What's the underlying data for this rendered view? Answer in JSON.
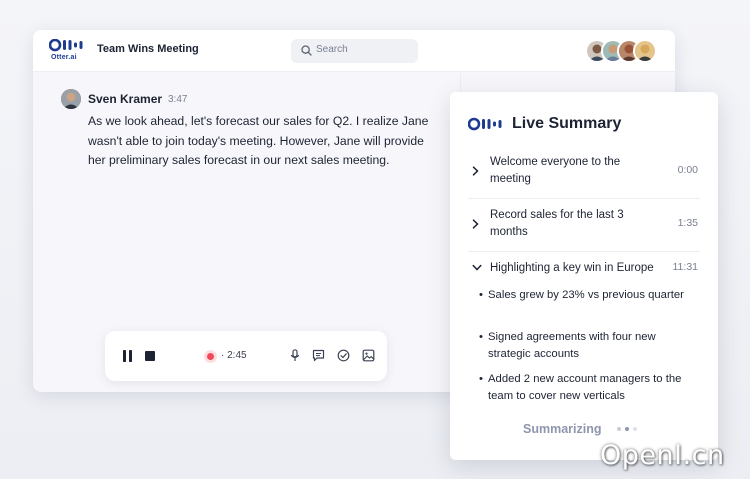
{
  "app": {
    "logo_text": "Otter.ai",
    "meeting_title": "Team Wins Meeting",
    "search_placeholder": "Search"
  },
  "participants": [
    {
      "name": "participant-1",
      "color": "#7d5a44"
    },
    {
      "name": "participant-2",
      "color": "#c99a76"
    },
    {
      "name": "participant-3",
      "color": "#9a5236"
    },
    {
      "name": "participant-4",
      "color": "#d8a85a"
    }
  ],
  "transcript": {
    "speaker": "Sven Kramer",
    "time": "3:47",
    "text": "As we look ahead, let's forecast our sales for Q2. I realize Jane wasn't able to join today's meeting. However, Jane will provide her preliminary sales forecast in our next sales meeting."
  },
  "player": {
    "elapsed": "2:45",
    "state": "recording"
  },
  "summary": {
    "title": "Live Summary",
    "items": [
      {
        "label": "Welcome everyone to the meeting",
        "time": "0:00",
        "expanded": false
      },
      {
        "label": "Record sales for the last 3 months",
        "time": "1:35",
        "expanded": false
      },
      {
        "label": "Highlighting a key win in Europe",
        "time": "11:31",
        "expanded": true,
        "bullets": [
          "Sales grew by 23% vs previous quarter",
          "Signed agreements with four new strategic accounts",
          "Added 2 new account managers to the team to cover new verticals"
        ]
      }
    ],
    "status": "Summarizing"
  },
  "watermark": "OpenI.cn",
  "colors": {
    "brand": "#1d3c8f",
    "recording": "#ef4a5a",
    "muted": "#7a8093"
  }
}
